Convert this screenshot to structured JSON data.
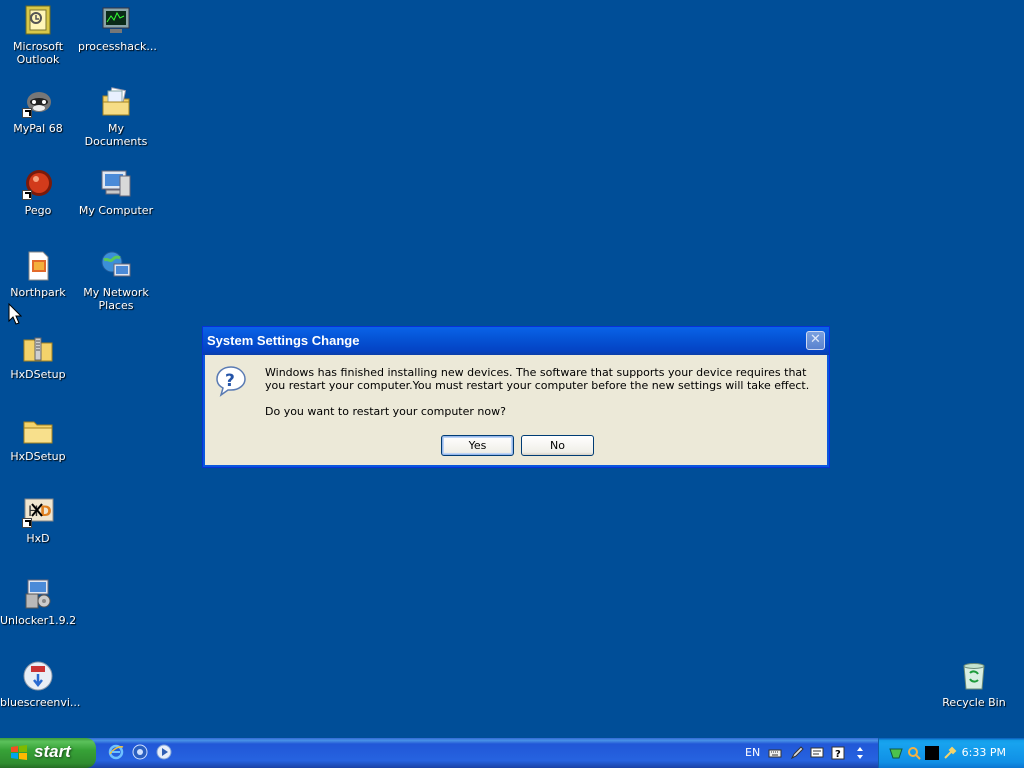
{
  "desktop": {
    "icons": [
      {
        "label": "Microsoft\nOutlook",
        "icon": "outlook-icon"
      },
      {
        "label": "processhack...",
        "icon": "process-hacker-icon"
      },
      {
        "label": "MyPal 68",
        "icon": "mypal-icon"
      },
      {
        "label": "My Documents",
        "icon": "my-documents-icon"
      },
      {
        "label": "Pego",
        "icon": "pego-icon"
      },
      {
        "label": "My Computer",
        "icon": "my-computer-icon"
      },
      {
        "label": "Northpark",
        "icon": "northpark-icon"
      },
      {
        "label": "My Network\nPlaces",
        "icon": "network-places-icon"
      },
      {
        "label": "HxDSetup",
        "icon": "zip-folder-icon"
      },
      {
        "label": "HxDSetup",
        "icon": "folder-icon"
      },
      {
        "label": "HxD",
        "icon": "hxd-icon"
      },
      {
        "label": "Unlocker1.9.2",
        "icon": "installer-icon"
      },
      {
        "label": "bluescreenvi...",
        "icon": "bluescreenview-icon"
      },
      {
        "label": "Recycle Bin",
        "icon": "recycle-bin-icon"
      }
    ]
  },
  "dialog": {
    "title": "System Settings Change",
    "close_glyph": "✕",
    "message": "Windows has finished installing new devices. The software that supports your device requires that you restart your computer.You must restart your computer before the new settings will take effect.",
    "question": "Do you want to restart your computer now?",
    "yes_label": "Yes",
    "no_label": "No"
  },
  "taskbar": {
    "start_label": "start",
    "language": "EN",
    "clock": "6:33 PM",
    "quick_launch": [
      "internet-explorer-icon",
      "browser-icon",
      "media-player-icon"
    ],
    "tray_icons": [
      "keyboard-icon",
      "pen-icon",
      "help-icon",
      "arrows-icon",
      "network-icon",
      "search-icon",
      "terminal-icon",
      "tool-icon"
    ]
  },
  "colors": {
    "desktop_bg": "#004e98",
    "title_bar": "#0554d6",
    "start_green": "#37a237",
    "dialog_bg": "#ece9d8"
  }
}
